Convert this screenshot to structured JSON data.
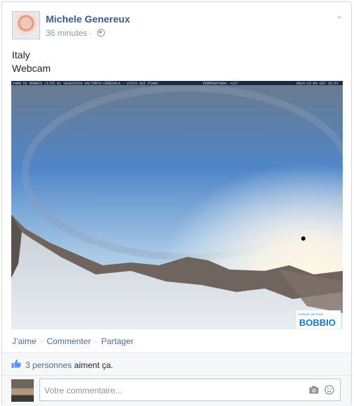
{
  "post": {
    "author": "Michele Genereux",
    "time": "36 minutes",
    "time_sep": "·",
    "privacy_icon": "globe-icon",
    "menu_icon": "chevron-down-icon",
    "text_line1": "Italy",
    "text_line2": "Webcam"
  },
  "photo": {
    "caption_bar": "FARO DI BOBBIO (1725 m) SEGGIOVIA VALTORTA-CERESOLA - VISTA SUI PIANI",
    "temperature": "TEMPERATURA: +13°",
    "timestamp": "2014-12-03 CET 15:57",
    "logo": "BOBBIO",
    "logo_small": "FUNIVIE DEI PIANI"
  },
  "actions": {
    "like": "J’aime",
    "comment": "Commenter",
    "share": "Partager",
    "sep": "·"
  },
  "likes": {
    "count_link": "3 personnes",
    "suffix": "aiment ça."
  },
  "comment": {
    "placeholder": "Votre commentaire...",
    "camera_icon": "camera-icon",
    "emoji_icon": "smiley-icon"
  },
  "colors": {
    "link": "#3b5998",
    "action_link": "#4b6aa8",
    "muted": "#90949c",
    "border": "#d4d6db",
    "logo_blue": "#1f7bbf"
  }
}
